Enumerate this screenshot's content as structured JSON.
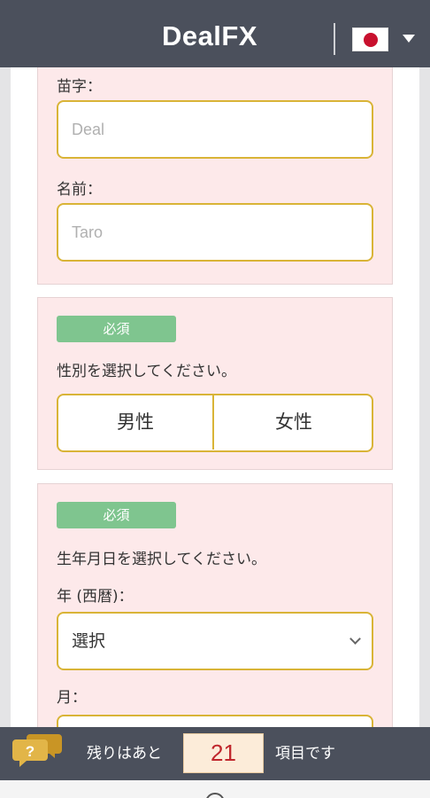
{
  "header": {
    "brand": "DealFX",
    "language_flag": "japan-flag-icon"
  },
  "name_panel": {
    "last_name_label": "苗字：",
    "last_name_placeholder": "Deal",
    "first_name_label": "名前：",
    "first_name_placeholder": "Taro"
  },
  "gender_panel": {
    "badge": "必須",
    "prompt": "性別を選択してください。",
    "options": [
      "男性",
      "女性"
    ]
  },
  "birth_panel": {
    "badge": "必須",
    "prompt": "生年月日を選択してください。",
    "year_label": "年 (西暦)：",
    "year_value": "選択",
    "month_label": "月："
  },
  "footer": {
    "prefix": "残りはあと",
    "count": "21",
    "suffix": "項目です",
    "help_icon": "question-bubble-icon"
  },
  "colors": {
    "header_bg": "#4b505c",
    "panel_bg": "#fde9ea",
    "field_border": "#d9b437",
    "badge_bg": "#7fc58f",
    "counter_text": "#c0272d"
  }
}
